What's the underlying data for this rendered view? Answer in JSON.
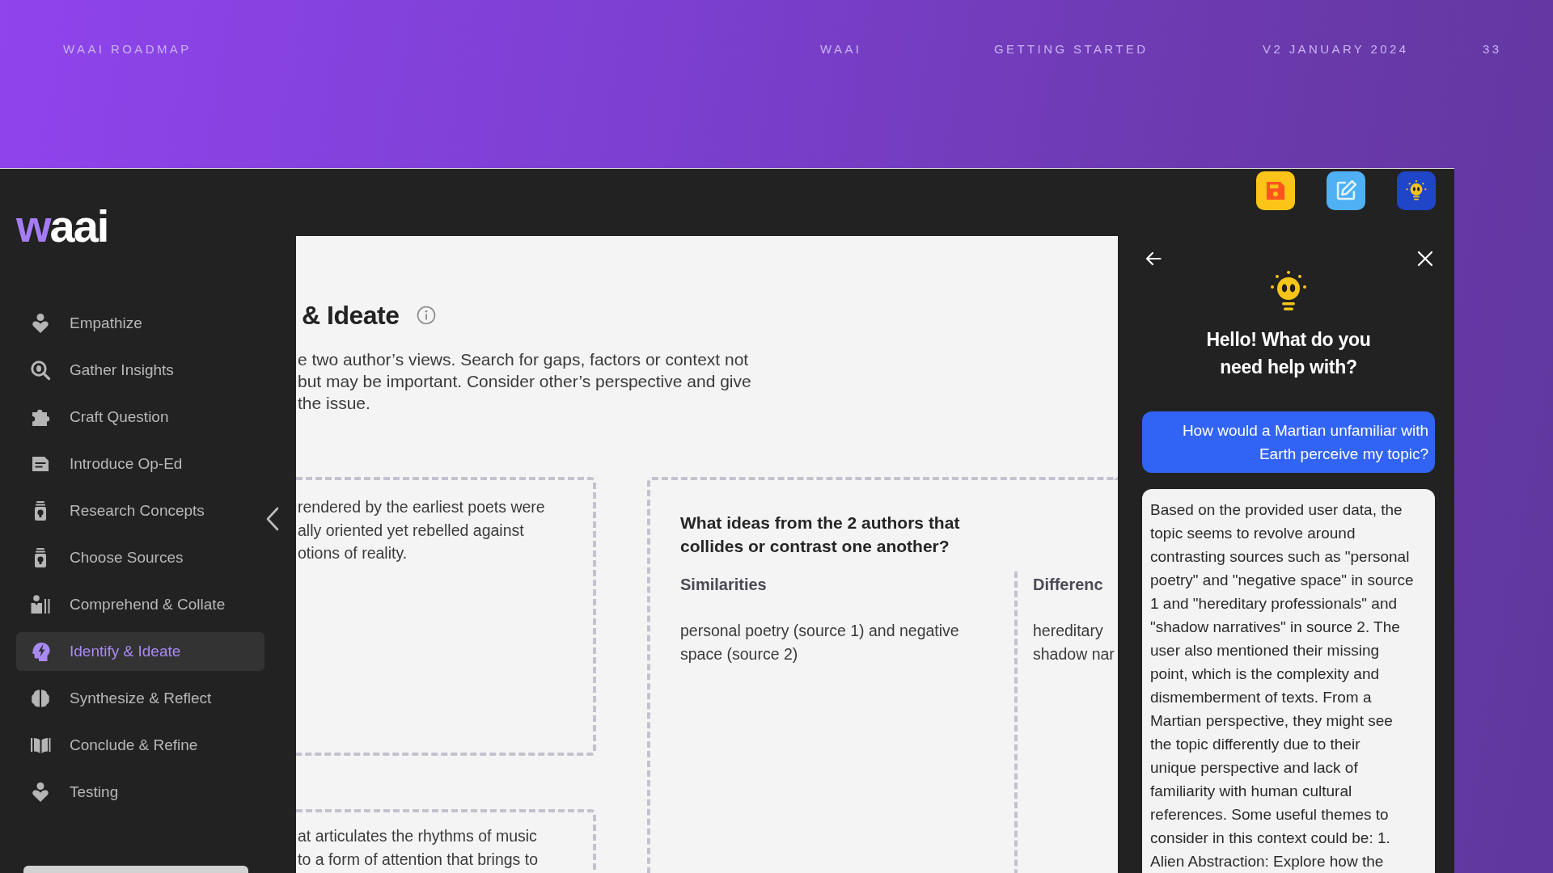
{
  "header": {
    "deck_title": "WAAI ROADMAP",
    "brand": "WAAI",
    "section": "GETTING STARTED",
    "version": "V2 JANUARY 2024",
    "page_number": "33"
  },
  "app": {
    "logo": "waai",
    "sidebar": {
      "items": [
        {
          "label": "Empathize",
          "selected": false
        },
        {
          "label": "Gather Insights",
          "selected": false
        },
        {
          "label": "Craft Question",
          "selected": false
        },
        {
          "label": "Introduce Op-Ed",
          "selected": false
        },
        {
          "label": "Research Concepts",
          "selected": false
        },
        {
          "label": "Choose Sources",
          "selected": false
        },
        {
          "label": "Comprehend & Collate",
          "selected": false
        },
        {
          "label": "Identify & Ideate",
          "selected": true
        },
        {
          "label": "Synthesize & Reflect",
          "selected": false
        },
        {
          "label": "Conclude & Refine",
          "selected": false
        },
        {
          "label": "Testing",
          "selected": false
        }
      ]
    },
    "page": {
      "title": "& Ideate",
      "description_lines": [
        "e two author’s views. Search for gaps, factors or context not",
        "but may be important. Consider other’s perspective and give",
        "the issue."
      ],
      "note_cards": [
        {
          "lines": [
            "rendered by the earliest poets were",
            "ally oriented yet rebelled against",
            "otions of reality."
          ]
        },
        {
          "lines": [
            "at articulates the rhythms of music",
            "to a form of attention that brings to"
          ]
        }
      ],
      "question_card": {
        "question": "What ideas from the 2 authors that collides or contrast one another?",
        "columns": [
          {
            "heading": "Similarities",
            "lines": [
              "personal poetry (source 1) and negative",
              "space (source 2)"
            ]
          },
          {
            "heading": "Differenc",
            "lines": [
              "hereditary",
              "shadow nar"
            ]
          }
        ]
      }
    },
    "assistant": {
      "greeting": "Hello! What do you need help with?",
      "messages": [
        {
          "kind": "user",
          "lines": [
            "How would a Martian unfamiliar with",
            "Earth perceive my topic?"
          ]
        },
        {
          "kind": "assistant",
          "lines": [
            "Based on the provided user data, the",
            "topic seems to revolve around",
            "contrasting sources such as \"personal",
            "poetry\" and \"negative space\" in source",
            "1 and \"hereditary professionals\" and",
            "\"shadow narratives\" in source 2. The",
            "user also mentioned their missing",
            "point, which is the complexity and",
            "dismemberment of texts. From a",
            "Martian perspective, they might see",
            "the topic differently due to their",
            "unique perspective and lack of",
            "familiarity with human cultural",
            "references. Some useful themes to",
            "consider in this context could be: 1.",
            "Alien Abstraction: Explore how the"
          ]
        }
      ]
    }
  }
}
